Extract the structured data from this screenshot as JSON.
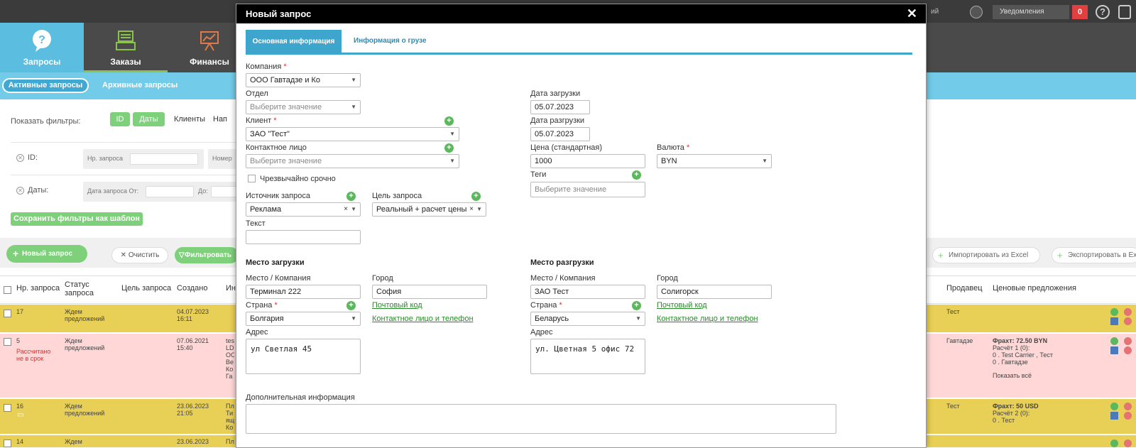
{
  "topbar": {
    "user_text": "ий",
    "notif_placeholder": "Уведомления",
    "notif_count": "0",
    "help": "?"
  },
  "nav": {
    "requests": "Запросы",
    "orders": "Заказы",
    "finance": "Финансы"
  },
  "subnav": {
    "active": "Активные запросы",
    "archive": "Архивные запросы"
  },
  "filters": {
    "show_label": "Показать фильтры:",
    "chips": [
      "ID",
      "Даты",
      "Клиенты",
      "Нап"
    ],
    "id_label": "ID:",
    "id_field": "Нр. запроса",
    "id_field2": "Номер",
    "dates_label": "Даты:",
    "date_from": "Дата запроса От:",
    "date_to": "До:",
    "save_template": "Сохранить фильтры как шаблон"
  },
  "toolbar": {
    "new": "Новый запрос",
    "clear": "Очистить",
    "filter": "Фильтровать",
    "import": "Импортировать из Excel",
    "export": "Экспортировать в Excel"
  },
  "table": {
    "headers": {
      "num": "Нр. запроса",
      "status": "Статус запроса",
      "goal": "Цель запроса",
      "created": "Создано",
      "info": "Ин",
      "seller": "Продавец",
      "offers": "Ценовые предложения"
    },
    "rows": [
      {
        "num": "17",
        "status": "Ждем предложений",
        "note": "",
        "created": "04.07.2023 16:11",
        "info": "",
        "seller": "Тест",
        "offers": []
      },
      {
        "num": "5",
        "status": "Ждем предложений",
        "note": "Рассчитано не в срок",
        "created": "07.06.2021 15:40",
        "info": "tes LD ОО Be Ко Га",
        "seller": "Гавтадзе",
        "offers": [
          "Фрахт: 72.50 BYN",
          "Расчёт 1 (0):",
          "0 . Test Carrier , Тест",
          "0 . Гавтадзе",
          "Показать всё"
        ]
      },
      {
        "num": "16",
        "status": "Ждем предложений",
        "note": "",
        "created": "23.06.2023 21:05",
        "info": "Пл Ти ящ Ко",
        "seller": "Тест",
        "offers": [
          "Фрахт: 50 USD",
          "Расчёт 2 (0):",
          "0 . Тест"
        ]
      },
      {
        "num": "14",
        "status": "Ждем",
        "note": "",
        "created": "23.06.2023",
        "info": "Пл",
        "seller": "",
        "offers": []
      }
    ]
  },
  "modal": {
    "title": "Новый запрос",
    "tabs": [
      "Основная информация",
      "Информация о грузе"
    ],
    "company_label": "Компания",
    "company_value": "ООО Гавтадзе и Ко",
    "dept_label": "Отдел",
    "dept_placeholder": "Выберите значение",
    "client_label": "Клиент",
    "client_value": "ЗАО \"Тест\"",
    "contact_label": "Контактное лицо",
    "contact_placeholder": "Выберите значение",
    "urgent_label": "Чрезвычайно срочно",
    "source_label": "Источник запроса",
    "source_value": "Реклама",
    "goal_label": "Цель запроса",
    "goal_value": "Реальный + расчет цены",
    "text_label": "Текст",
    "load_date_label": "Дата загрузки",
    "load_date_value": "05.07.2023",
    "unload_date_label": "Дата разгрузки",
    "unload_date_value": "05.07.2023",
    "price_label": "Цена (стандартная)",
    "price_value": "1000",
    "currency_label": "Валюта",
    "currency_value": "BYN",
    "tags_label": "Теги",
    "tags_placeholder": "Выберите значение",
    "load_place": {
      "section": "Место загрузки",
      "place_label": "Место / Компания",
      "place_value": "Терминал 222",
      "city_label": "Город",
      "city_value": "София",
      "country_label": "Страна",
      "country_value": "Болгария",
      "postal_link": "Почтовый код",
      "contact_link": "Контактное лицо и телефон",
      "address_label": "Адрес",
      "address_value": "ул Светлая 45"
    },
    "unload_place": {
      "section": "Место разгрузки",
      "place_label": "Место / Компания",
      "place_value": "ЗАО Тест",
      "city_label": "Город",
      "city_value": "Солигорск",
      "country_label": "Страна",
      "country_value": "Беларусь",
      "postal_link": "Почтовый код",
      "contact_link": "Контактное лицо и телефон",
      "address_label": "Адрес",
      "address_value": "ул. Цветная 5 офис 72"
    },
    "extra_label": "Дополнительная информация"
  },
  "colors": {
    "accent": "#3ea6cc",
    "green": "#7ed07a",
    "row_yellow": "#e8cf56",
    "row_pink": "#ffd7d7",
    "required": "#e03030"
  }
}
